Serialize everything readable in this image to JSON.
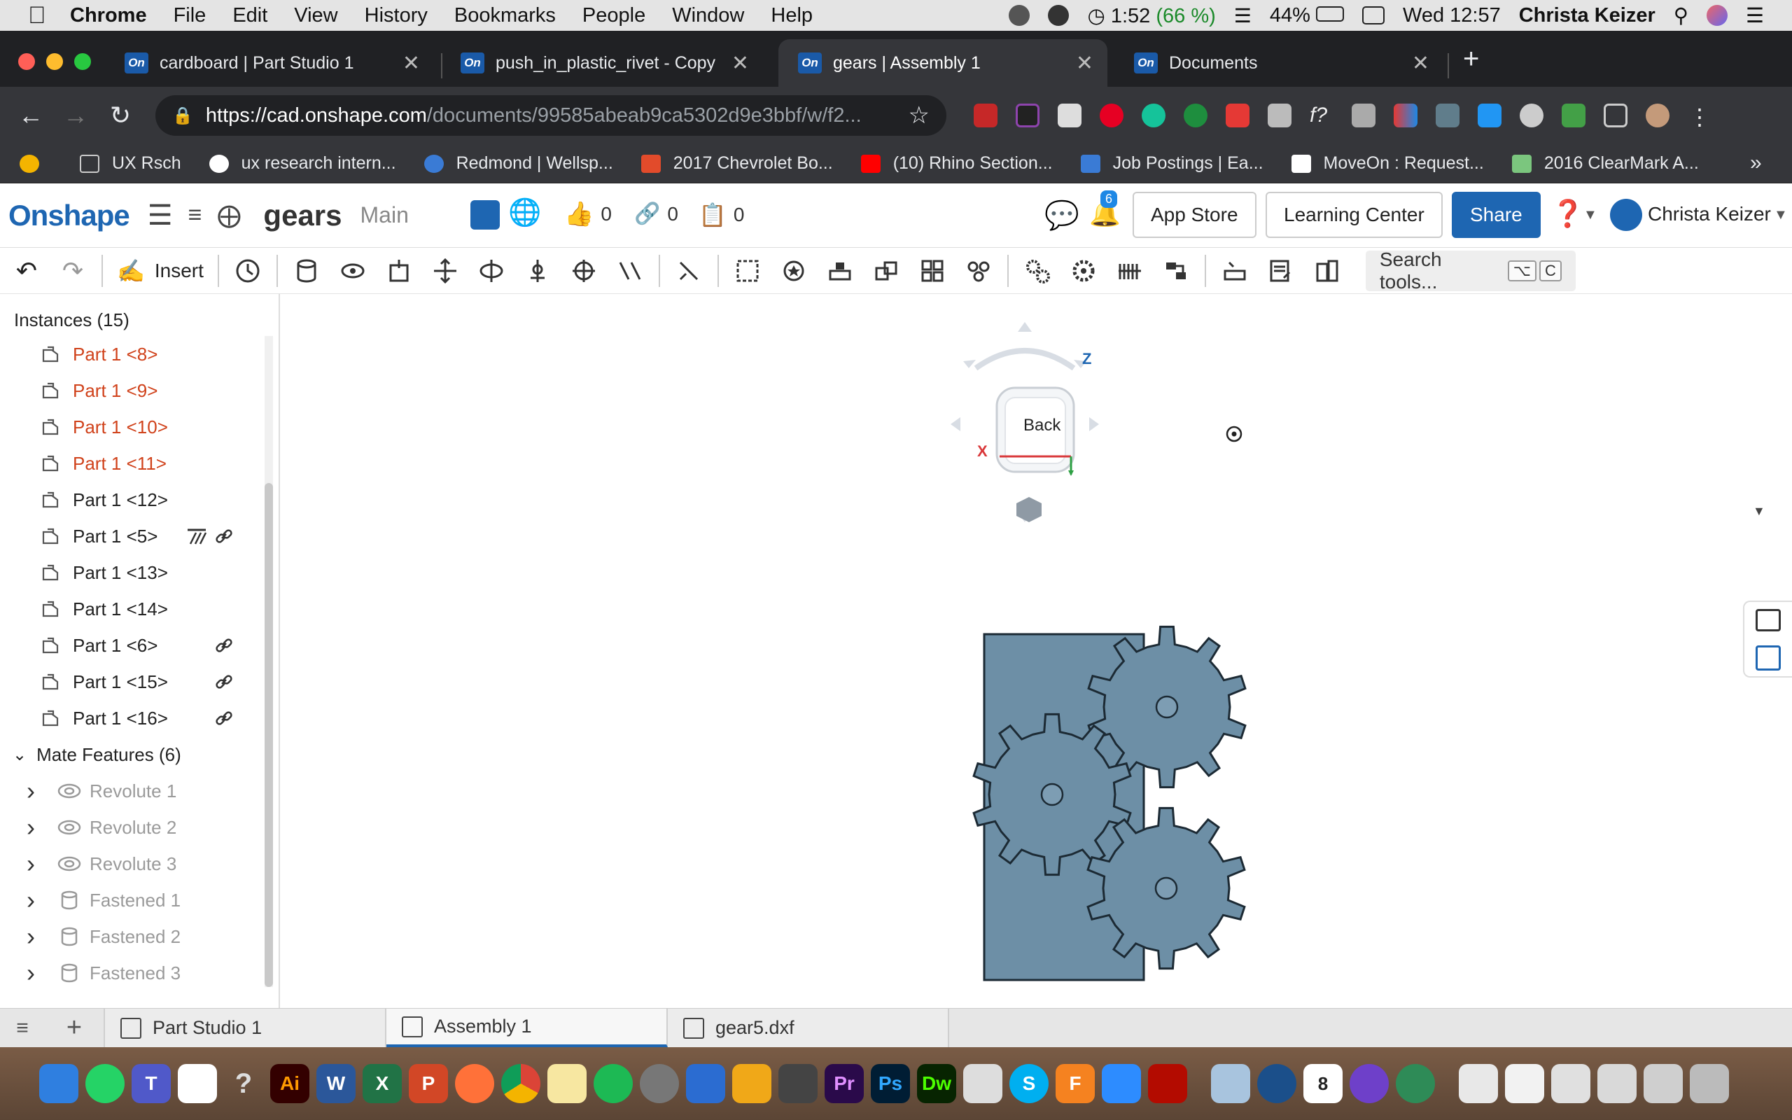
{
  "menubar": {
    "app_name": "Chrome",
    "items": [
      "File",
      "Edit",
      "View",
      "History",
      "Bookmarks",
      "People",
      "Window",
      "Help"
    ],
    "timer": "1:52",
    "timer_pct": "(66 %)",
    "battery": "44%",
    "clock": "Wed 12:57",
    "user": "Christa Keizer"
  },
  "tabs": [
    {
      "label": "cardboard | Part Studio 1",
      "favicon": "On",
      "active": false
    },
    {
      "label": "push_in_plastic_rivet - Copy | P",
      "favicon": "On",
      "active": false
    },
    {
      "label": "gears | Assembly 1",
      "favicon": "On",
      "active": true
    },
    {
      "label": "Documents",
      "favicon": "On",
      "active": false
    }
  ],
  "address": {
    "scheme": "https://",
    "host": "cad.onshape.com",
    "path": "/documents/99585abeab9ca5302d9e3bbf/w/f2..."
  },
  "bookmarks": [
    {
      "label": "UX Rsch",
      "color": "#9aa0a6"
    },
    {
      "label": "ux research intern...",
      "color": "#ffffff"
    },
    {
      "label": "Redmond | Wellsp...",
      "color": "#3a7bd5"
    },
    {
      "label": "2017 Chevrolet Bo...",
      "color": "#e24b2b"
    },
    {
      "label": "(10) Rhino Section...",
      "color": "#ff0000"
    },
    {
      "label": "Job Postings | Ea...",
      "color": "#3a7bd5"
    },
    {
      "label": "MoveOn : Request...",
      "color": "#ffffff"
    },
    {
      "label": "2016 ClearMark A...",
      "color": "#7bc67e"
    }
  ],
  "header": {
    "logo": "Onshape",
    "doc_title": "gears",
    "branch": "Main",
    "likes": "0",
    "links": "0",
    "copies": "0",
    "notifications": "6",
    "app_store": "App Store",
    "learning_center": "Learning Center",
    "share": "Share",
    "user": "Christa Keizer"
  },
  "toolbar": {
    "insert": "Insert",
    "search_placeholder": "Search tools...",
    "search_key1": "⌥",
    "search_key2": "C"
  },
  "instances": {
    "header": "Instances (15)",
    "items": [
      {
        "label": "Part 1 <8>",
        "state": "error"
      },
      {
        "label": "Part 1 <9>",
        "state": "error"
      },
      {
        "label": "Part 1 <10>",
        "state": "error"
      },
      {
        "label": "Part 1 <11>",
        "state": "error"
      },
      {
        "label": "Part 1 <12>",
        "state": "normal"
      },
      {
        "label": "Part 1 <5>",
        "state": "fixed-linked"
      },
      {
        "label": "Part 1 <13>",
        "state": "normal"
      },
      {
        "label": "Part 1 <14>",
        "state": "normal"
      },
      {
        "label": "Part 1 <6>",
        "state": "linked"
      },
      {
        "label": "Part 1 <15>",
        "state": "linked"
      },
      {
        "label": "Part 1 <16>",
        "state": "linked"
      }
    ]
  },
  "mates": {
    "header": "Mate Features (6)",
    "items": [
      {
        "label": "Revolute 1",
        "type": "revolute"
      },
      {
        "label": "Revolute 2",
        "type": "revolute"
      },
      {
        "label": "Revolute 3",
        "type": "revolute"
      },
      {
        "label": "Fastened 1",
        "type": "fastened"
      },
      {
        "label": "Fastened 2",
        "type": "fastened"
      },
      {
        "label": "Fastened 3",
        "type": "fastened"
      }
    ]
  },
  "viewcube": {
    "face": "Back",
    "axis_z": "Z",
    "axis_x": "X"
  },
  "bottom_tabs": [
    {
      "label": "Part Studio 1",
      "active": false
    },
    {
      "label": "Assembly 1",
      "active": true
    },
    {
      "label": "gear5.dxf",
      "active": false
    }
  ],
  "colors": {
    "onshape_blue": "#1e66b2",
    "error_red": "#d0421b",
    "part_fill": "#6d8fa6"
  }
}
